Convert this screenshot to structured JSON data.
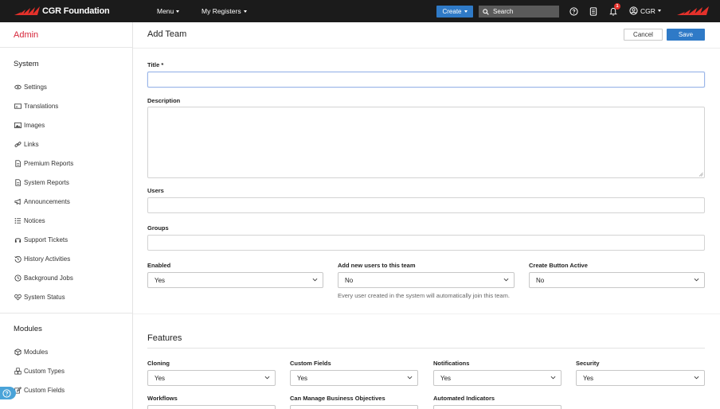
{
  "topbar": {
    "brand": "CGR Foundation",
    "menu_label": "Menu",
    "registers_label": "My Registers",
    "create_label": "Create",
    "search_label": "Search",
    "notification_count": "1",
    "user_label": "CGR",
    "icons": [
      "help-circle-icon",
      "book-icon",
      "bell-icon",
      "user-circle-icon"
    ],
    "accent_color": "#2f7ac7",
    "brand_color": "#e4312b"
  },
  "sidebar": {
    "title": "Admin",
    "title_color": "#d6263a",
    "system_title": "System",
    "system_items": [
      {
        "label": "Settings",
        "icon": "eye-icon"
      },
      {
        "label": "Translations",
        "icon": "translate-icon"
      },
      {
        "label": "Images",
        "icon": "image-icon"
      },
      {
        "label": "Links",
        "icon": "link-icon"
      },
      {
        "label": "Premium Reports",
        "icon": "file-icon"
      },
      {
        "label": "System Reports",
        "icon": "file-icon"
      },
      {
        "label": "Announcements",
        "icon": "megaphone-icon"
      },
      {
        "label": "Notices",
        "icon": "list-icon"
      },
      {
        "label": "Support Tickets",
        "icon": "headset-icon"
      },
      {
        "label": "History Activities",
        "icon": "history-icon"
      },
      {
        "label": "Background Jobs",
        "icon": "clock-icon"
      },
      {
        "label": "System Status",
        "icon": "heartbeat-icon"
      }
    ],
    "modules_title": "Modules",
    "module_items": [
      {
        "label": "Modules",
        "icon": "cube-icon"
      },
      {
        "label": "Custom Types",
        "icon": "cubes-icon"
      },
      {
        "label": "Custom Fields",
        "icon": "edit-icon"
      }
    ]
  },
  "main": {
    "title": "Add Team",
    "cancel_label": "Cancel",
    "save_label": "Save",
    "title_label": "Title *",
    "title_value": "",
    "description_label": "Description",
    "users_label": "Users",
    "groups_label": "Groups",
    "enabled_label": "Enabled",
    "enabled_value": "Yes",
    "add_new_users_label": "Add new users to this team",
    "add_new_users_value": "No",
    "add_new_users_help": "Every user created in the system will automatically join this team.",
    "create_button_label": "Create Button Active",
    "create_button_value": "No"
  },
  "features": {
    "heading": "Features",
    "fields": [
      {
        "label": "Cloning",
        "value": "Yes"
      },
      {
        "label": "Custom Fields",
        "value": "Yes"
      },
      {
        "label": "Notifications",
        "value": "Yes"
      },
      {
        "label": "Security",
        "value": "Yes"
      },
      {
        "label": "Workflows",
        "value": ""
      },
      {
        "label": "Can Manage Business Objectives",
        "value": ""
      },
      {
        "label": "Automated Indicators",
        "value": ""
      }
    ]
  }
}
